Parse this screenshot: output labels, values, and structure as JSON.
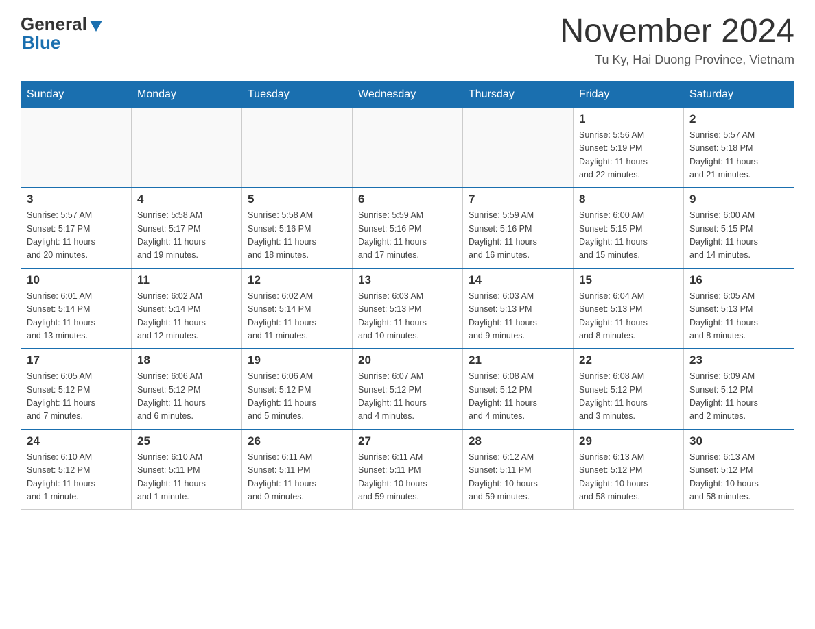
{
  "header": {
    "logo_line1": "General",
    "logo_line2": "Blue",
    "month_title": "November 2024",
    "location": "Tu Ky, Hai Duong Province, Vietnam"
  },
  "weekdays": [
    "Sunday",
    "Monday",
    "Tuesday",
    "Wednesday",
    "Thursday",
    "Friday",
    "Saturday"
  ],
  "weeks": [
    [
      {
        "day": "",
        "info": ""
      },
      {
        "day": "",
        "info": ""
      },
      {
        "day": "",
        "info": ""
      },
      {
        "day": "",
        "info": ""
      },
      {
        "day": "",
        "info": ""
      },
      {
        "day": "1",
        "info": "Sunrise: 5:56 AM\nSunset: 5:19 PM\nDaylight: 11 hours\nand 22 minutes."
      },
      {
        "day": "2",
        "info": "Sunrise: 5:57 AM\nSunset: 5:18 PM\nDaylight: 11 hours\nand 21 minutes."
      }
    ],
    [
      {
        "day": "3",
        "info": "Sunrise: 5:57 AM\nSunset: 5:17 PM\nDaylight: 11 hours\nand 20 minutes."
      },
      {
        "day": "4",
        "info": "Sunrise: 5:58 AM\nSunset: 5:17 PM\nDaylight: 11 hours\nand 19 minutes."
      },
      {
        "day": "5",
        "info": "Sunrise: 5:58 AM\nSunset: 5:16 PM\nDaylight: 11 hours\nand 18 minutes."
      },
      {
        "day": "6",
        "info": "Sunrise: 5:59 AM\nSunset: 5:16 PM\nDaylight: 11 hours\nand 17 minutes."
      },
      {
        "day": "7",
        "info": "Sunrise: 5:59 AM\nSunset: 5:16 PM\nDaylight: 11 hours\nand 16 minutes."
      },
      {
        "day": "8",
        "info": "Sunrise: 6:00 AM\nSunset: 5:15 PM\nDaylight: 11 hours\nand 15 minutes."
      },
      {
        "day": "9",
        "info": "Sunrise: 6:00 AM\nSunset: 5:15 PM\nDaylight: 11 hours\nand 14 minutes."
      }
    ],
    [
      {
        "day": "10",
        "info": "Sunrise: 6:01 AM\nSunset: 5:14 PM\nDaylight: 11 hours\nand 13 minutes."
      },
      {
        "day": "11",
        "info": "Sunrise: 6:02 AM\nSunset: 5:14 PM\nDaylight: 11 hours\nand 12 minutes."
      },
      {
        "day": "12",
        "info": "Sunrise: 6:02 AM\nSunset: 5:14 PM\nDaylight: 11 hours\nand 11 minutes."
      },
      {
        "day": "13",
        "info": "Sunrise: 6:03 AM\nSunset: 5:13 PM\nDaylight: 11 hours\nand 10 minutes."
      },
      {
        "day": "14",
        "info": "Sunrise: 6:03 AM\nSunset: 5:13 PM\nDaylight: 11 hours\nand 9 minutes."
      },
      {
        "day": "15",
        "info": "Sunrise: 6:04 AM\nSunset: 5:13 PM\nDaylight: 11 hours\nand 8 minutes."
      },
      {
        "day": "16",
        "info": "Sunrise: 6:05 AM\nSunset: 5:13 PM\nDaylight: 11 hours\nand 8 minutes."
      }
    ],
    [
      {
        "day": "17",
        "info": "Sunrise: 6:05 AM\nSunset: 5:12 PM\nDaylight: 11 hours\nand 7 minutes."
      },
      {
        "day": "18",
        "info": "Sunrise: 6:06 AM\nSunset: 5:12 PM\nDaylight: 11 hours\nand 6 minutes."
      },
      {
        "day": "19",
        "info": "Sunrise: 6:06 AM\nSunset: 5:12 PM\nDaylight: 11 hours\nand 5 minutes."
      },
      {
        "day": "20",
        "info": "Sunrise: 6:07 AM\nSunset: 5:12 PM\nDaylight: 11 hours\nand 4 minutes."
      },
      {
        "day": "21",
        "info": "Sunrise: 6:08 AM\nSunset: 5:12 PM\nDaylight: 11 hours\nand 4 minutes."
      },
      {
        "day": "22",
        "info": "Sunrise: 6:08 AM\nSunset: 5:12 PM\nDaylight: 11 hours\nand 3 minutes."
      },
      {
        "day": "23",
        "info": "Sunrise: 6:09 AM\nSunset: 5:12 PM\nDaylight: 11 hours\nand 2 minutes."
      }
    ],
    [
      {
        "day": "24",
        "info": "Sunrise: 6:10 AM\nSunset: 5:12 PM\nDaylight: 11 hours\nand 1 minute."
      },
      {
        "day": "25",
        "info": "Sunrise: 6:10 AM\nSunset: 5:11 PM\nDaylight: 11 hours\nand 1 minute."
      },
      {
        "day": "26",
        "info": "Sunrise: 6:11 AM\nSunset: 5:11 PM\nDaylight: 11 hours\nand 0 minutes."
      },
      {
        "day": "27",
        "info": "Sunrise: 6:11 AM\nSunset: 5:11 PM\nDaylight: 10 hours\nand 59 minutes."
      },
      {
        "day": "28",
        "info": "Sunrise: 6:12 AM\nSunset: 5:11 PM\nDaylight: 10 hours\nand 59 minutes."
      },
      {
        "day": "29",
        "info": "Sunrise: 6:13 AM\nSunset: 5:12 PM\nDaylight: 10 hours\nand 58 minutes."
      },
      {
        "day": "30",
        "info": "Sunrise: 6:13 AM\nSunset: 5:12 PM\nDaylight: 10 hours\nand 58 minutes."
      }
    ]
  ]
}
